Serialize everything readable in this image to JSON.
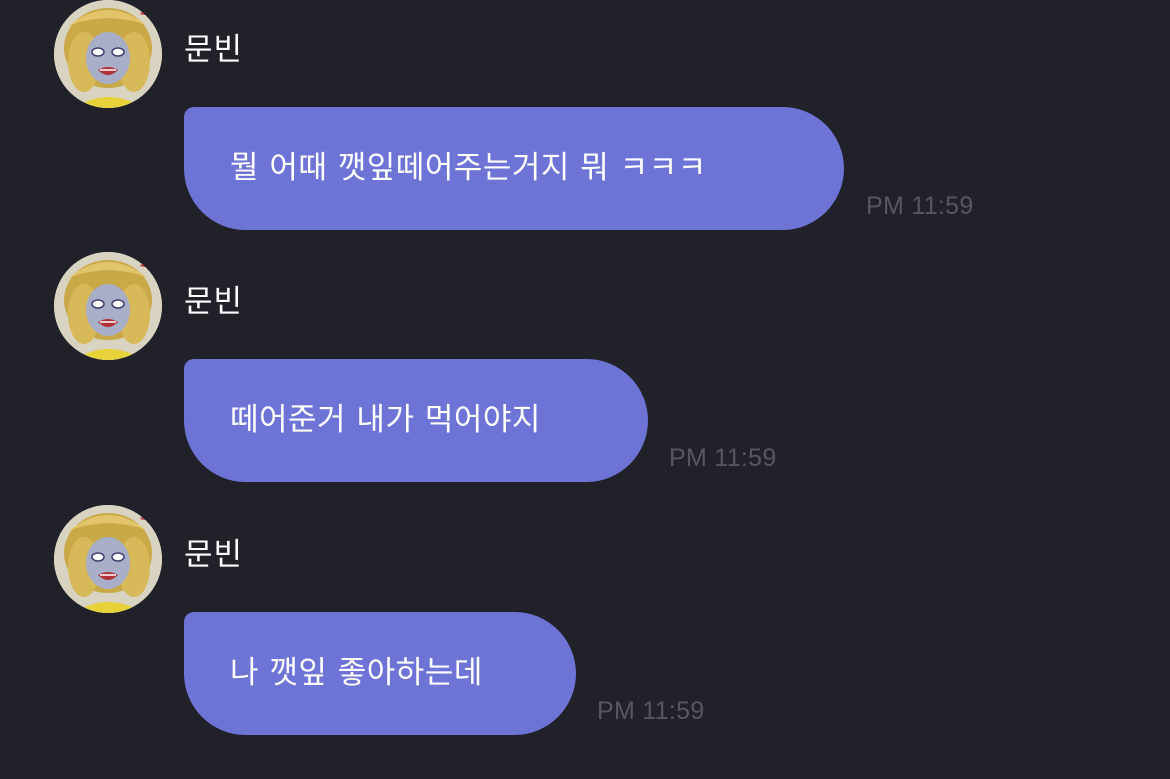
{
  "messages": [
    {
      "sender": "문빈",
      "text": "뭘 어때 깻잎떼어주는거지 뭐 ㅋㅋㅋ",
      "time": "PM 11:59",
      "avatar": "profile-avatar"
    },
    {
      "sender": "문빈",
      "text": "떼어준거 내가 먹어야지",
      "time": "PM 11:59",
      "avatar": "profile-avatar"
    },
    {
      "sender": "문빈",
      "text": "나 깻잎 좋아하는데",
      "time": "PM 11:59",
      "avatar": "profile-avatar"
    }
  ],
  "colors": {
    "background": "#21212a",
    "bubble": "#6e74d6",
    "sender_text": "#ffffff",
    "message_text": "#ffffff",
    "timestamp": "#575761"
  }
}
